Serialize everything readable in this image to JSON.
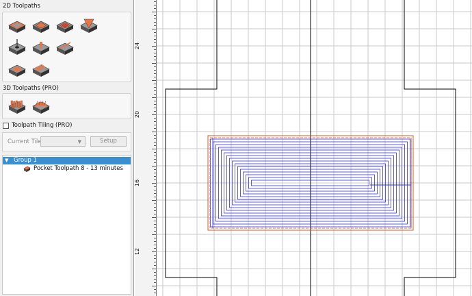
{
  "panel": {
    "section_2d_title": "2D Toolpaths",
    "section_3d_title": "3D Toolpaths (PRO)",
    "tiling": {
      "label": "Toolpath Tiling (PRO)",
      "checked": false
    },
    "current_tile": {
      "label": "Current Tile",
      "value": "",
      "setup_label": "Setup"
    },
    "tools_2d": [
      {
        "name": "profile-toolpath-icon"
      },
      {
        "name": "pocket-toolpath-icon"
      },
      {
        "name": "quick-engrave-toolpath-icon"
      },
      {
        "name": "v-carve-toolpath-icon"
      },
      {
        "name": "drilling-toolpath-icon"
      },
      {
        "name": "fluting-toolpath-icon"
      },
      {
        "name": "texture-toolpath-icon"
      },
      {
        "name": "prism-toolpath-icon"
      },
      {
        "name": "moulding-toolpath-icon"
      }
    ],
    "tools_3d": [
      {
        "name": "3d-roughing-toolpath-icon"
      },
      {
        "name": "3d-finishing-toolpath-icon"
      }
    ]
  },
  "tree": {
    "group": {
      "label": "Group 1",
      "expanded": true
    },
    "items": [
      {
        "label": "Pocket Toolpath 8 - 13 minutes",
        "icon": "pocket-toolpath-icon"
      }
    ]
  },
  "ruler": {
    "labels": [
      "24",
      "20",
      "16",
      "12"
    ]
  },
  "colors": {
    "selection_blue": "#3a8fd0",
    "toolpath_blue": "#3333dd",
    "boundary_orange": "#e2551c",
    "tool_orange": "#e8744a",
    "grid": "#c9c9c9",
    "geometry": "#000000"
  }
}
